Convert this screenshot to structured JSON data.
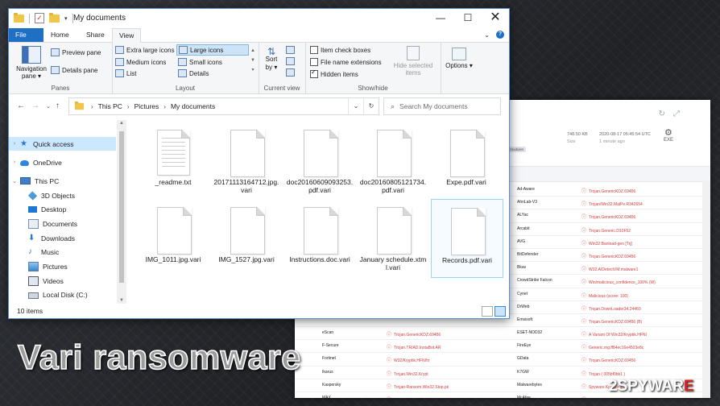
{
  "window": {
    "title": "My documents",
    "minimize_glyph": "—",
    "maximize_glyph": "☐",
    "close_glyph": "✕"
  },
  "tabs": [
    {
      "label": "File"
    },
    {
      "label": "Home"
    },
    {
      "label": "Share"
    },
    {
      "label": "View"
    }
  ],
  "ribbon": {
    "panes": {
      "label": "Panes",
      "navigation_pane": "Navigation pane ▾",
      "preview_pane": "Preview pane",
      "details_pane": "Details pane"
    },
    "layout": {
      "label": "Layout",
      "extra_large_icons": "Extra large icons",
      "large_icons": "Large icons",
      "medium_icons": "Medium icons",
      "small_icons": "Small icons",
      "list": "List",
      "details": "Details"
    },
    "current_view": {
      "label": "Current view",
      "sort_by": "Sort by ▾"
    },
    "show_hide": {
      "label": "Show/hide",
      "item_check_boxes": "Item check boxes",
      "file_name_extensions": "File name extensions",
      "hidden_items": "Hidden items",
      "hide_selected_items": "Hide selected items"
    },
    "options": {
      "label": "Options",
      "text": "Options ▾"
    }
  },
  "address": {
    "crumbs": [
      "This PC",
      "Pictures",
      "My documents"
    ],
    "separator": "›"
  },
  "search": {
    "placeholder": "Search My documents"
  },
  "navigation": [
    {
      "label": "Quick access",
      "icon": "star-icon"
    },
    {
      "label": "OneDrive",
      "icon": "cloud-icon"
    },
    {
      "label": "This PC",
      "icon": "computer-icon"
    },
    {
      "label": "3D Objects",
      "icon": "cube-icon"
    },
    {
      "label": "Desktop",
      "icon": "desktop-icon"
    },
    {
      "label": "Documents",
      "icon": "documents-icon"
    },
    {
      "label": "Downloads",
      "icon": "download-icon"
    },
    {
      "label": "Music",
      "icon": "music-icon"
    },
    {
      "label": "Pictures",
      "icon": "pictures-icon"
    },
    {
      "label": "Videos",
      "icon": "videos-icon"
    },
    {
      "label": "Local Disk (C:)",
      "icon": "drive-icon"
    }
  ],
  "files": [
    {
      "name": "_readme.txt"
    },
    {
      "name": "20171113164712.jpg.vari"
    },
    {
      "name": "doc20160609093253.pdf.vari"
    },
    {
      "name": "doc20160805121734.pdf.vari"
    },
    {
      "name": "Expe.pdf.vari"
    },
    {
      "name": "IMG_1011.jpg.vari"
    },
    {
      "name": "IMG_1527.jpg.vari"
    },
    {
      "name": "Instructions.doc.vari"
    },
    {
      "name": "January schedule.xtml.vari"
    },
    {
      "name": "Records.pdf.vari"
    }
  ],
  "status": {
    "item_count": "10 items"
  },
  "scan_report": {
    "size": "748.50 KB",
    "size_label": "Size",
    "date": "2020-08-17 05:45:54 UTC",
    "date_label": "1 minute ago",
    "type": "EXE",
    "chip": "ome-modules",
    "rows": [
      {
        "a": "",
        "ad": "",
        "b": "Ad-Aware",
        "bd": "Trojan.GenericKDZ.69456"
      },
      {
        "a": "",
        "ad": "",
        "b": "AhnLab-V3",
        "bd": "Trojan/Win32.MalPe.R342654"
      },
      {
        "a": "",
        "ad": "",
        "b": "ALYac",
        "bd": "Trojan.GenericKDZ.69456"
      },
      {
        "a": "",
        "ad": "",
        "b": "Arcabit",
        "bd": "Trojan.Generic.D10F52"
      },
      {
        "a": "",
        "ad": "",
        "b": "AVG",
        "bd": "Win32:Banload-gen [Trj]"
      },
      {
        "a": "",
        "ad": "",
        "b": "BitDefender",
        "bd": "Trojan.GenericKDZ.69456"
      },
      {
        "a": "",
        "ad": "",
        "b": "Bkav",
        "bd": "W32.AIDetectVM.malware1"
      },
      {
        "a": "",
        "ad": "",
        "b": "CrowdStrike Falcon",
        "bd": "Win/malicious_confidence_100% (W)"
      },
      {
        "a": "",
        "ad": "",
        "b": "Cynet",
        "bd": "Malicious (score: 100)"
      },
      {
        "a": "",
        "ad": "",
        "b": "DrWeb",
        "bd": "Trojan.DownLoader34.24460"
      },
      {
        "a": "",
        "ad": "",
        "b": "Emsisoft",
        "bd": "Trojan.GenericKDZ.69456 (B)"
      },
      {
        "a": "eScan",
        "ad": "Trojan.GenericKDZ.69456",
        "b": "ESET-NOD32",
        "bd": "A Variant Of Win32/Kryptik.HFNI"
      },
      {
        "a": "F-Secure",
        "ad": "Trojan.TR/AD.InstaBot.AR",
        "b": "FireEye",
        "bd": "Generic.mg.ff84ec16e4503e8c"
      },
      {
        "a": "Fortinet",
        "ad": "W32/Kryptik.HFNI!tr",
        "b": "GData",
        "bd": "Trojan.GenericKDZ.69456"
      },
      {
        "a": "Ikarus",
        "ad": "Trojan.Win32.Krypt",
        "b": "K7GW",
        "bd": "Trojan ( 005bf0bb1 )"
      },
      {
        "a": "Kaspersky",
        "ad": "Trojan-Ransom.Win32.Stop.pk",
        "b": "Malwarebytes",
        "bd": "Spyware.KpotStealer"
      },
      {
        "a": "MAX",
        "ad": "Malware (ai Score=100)",
        "b": "McAfee",
        "bd": "Artemis!FF84EC16E450"
      }
    ]
  },
  "overlay": {
    "headline": "Vari ransomware",
    "watermark_prefix": "2SPYWAR",
    "watermark_suffix": "E"
  }
}
